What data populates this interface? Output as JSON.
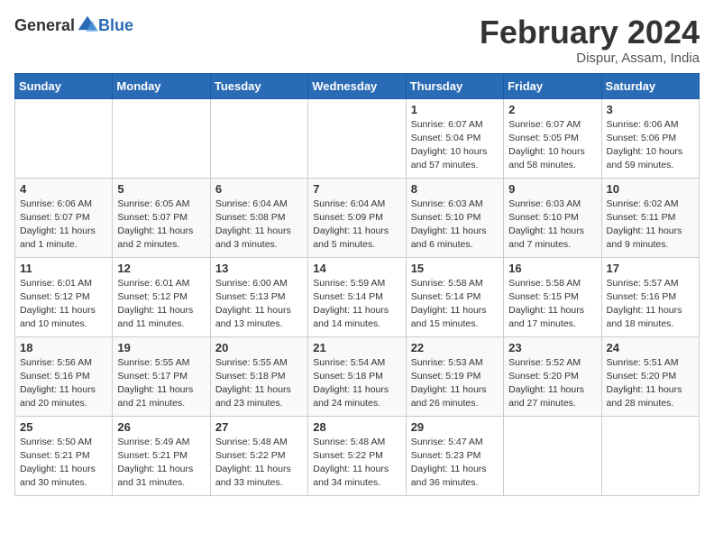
{
  "header": {
    "logo_general": "General",
    "logo_blue": "Blue",
    "month_title": "February 2024",
    "location": "Dispur, Assam, India"
  },
  "weekdays": [
    "Sunday",
    "Monday",
    "Tuesday",
    "Wednesday",
    "Thursday",
    "Friday",
    "Saturday"
  ],
  "weeks": [
    [
      {
        "day": "",
        "info": ""
      },
      {
        "day": "",
        "info": ""
      },
      {
        "day": "",
        "info": ""
      },
      {
        "day": "",
        "info": ""
      },
      {
        "day": "1",
        "info": "Sunrise: 6:07 AM\nSunset: 5:04 PM\nDaylight: 10 hours\nand 57 minutes."
      },
      {
        "day": "2",
        "info": "Sunrise: 6:07 AM\nSunset: 5:05 PM\nDaylight: 10 hours\nand 58 minutes."
      },
      {
        "day": "3",
        "info": "Sunrise: 6:06 AM\nSunset: 5:06 PM\nDaylight: 10 hours\nand 59 minutes."
      }
    ],
    [
      {
        "day": "4",
        "info": "Sunrise: 6:06 AM\nSunset: 5:07 PM\nDaylight: 11 hours\nand 1 minute."
      },
      {
        "day": "5",
        "info": "Sunrise: 6:05 AM\nSunset: 5:07 PM\nDaylight: 11 hours\nand 2 minutes."
      },
      {
        "day": "6",
        "info": "Sunrise: 6:04 AM\nSunset: 5:08 PM\nDaylight: 11 hours\nand 3 minutes."
      },
      {
        "day": "7",
        "info": "Sunrise: 6:04 AM\nSunset: 5:09 PM\nDaylight: 11 hours\nand 5 minutes."
      },
      {
        "day": "8",
        "info": "Sunrise: 6:03 AM\nSunset: 5:10 PM\nDaylight: 11 hours\nand 6 minutes."
      },
      {
        "day": "9",
        "info": "Sunrise: 6:03 AM\nSunset: 5:10 PM\nDaylight: 11 hours\nand 7 minutes."
      },
      {
        "day": "10",
        "info": "Sunrise: 6:02 AM\nSunset: 5:11 PM\nDaylight: 11 hours\nand 9 minutes."
      }
    ],
    [
      {
        "day": "11",
        "info": "Sunrise: 6:01 AM\nSunset: 5:12 PM\nDaylight: 11 hours\nand 10 minutes."
      },
      {
        "day": "12",
        "info": "Sunrise: 6:01 AM\nSunset: 5:12 PM\nDaylight: 11 hours\nand 11 minutes."
      },
      {
        "day": "13",
        "info": "Sunrise: 6:00 AM\nSunset: 5:13 PM\nDaylight: 11 hours\nand 13 minutes."
      },
      {
        "day": "14",
        "info": "Sunrise: 5:59 AM\nSunset: 5:14 PM\nDaylight: 11 hours\nand 14 minutes."
      },
      {
        "day": "15",
        "info": "Sunrise: 5:58 AM\nSunset: 5:14 PM\nDaylight: 11 hours\nand 15 minutes."
      },
      {
        "day": "16",
        "info": "Sunrise: 5:58 AM\nSunset: 5:15 PM\nDaylight: 11 hours\nand 17 minutes."
      },
      {
        "day": "17",
        "info": "Sunrise: 5:57 AM\nSunset: 5:16 PM\nDaylight: 11 hours\nand 18 minutes."
      }
    ],
    [
      {
        "day": "18",
        "info": "Sunrise: 5:56 AM\nSunset: 5:16 PM\nDaylight: 11 hours\nand 20 minutes."
      },
      {
        "day": "19",
        "info": "Sunrise: 5:55 AM\nSunset: 5:17 PM\nDaylight: 11 hours\nand 21 minutes."
      },
      {
        "day": "20",
        "info": "Sunrise: 5:55 AM\nSunset: 5:18 PM\nDaylight: 11 hours\nand 23 minutes."
      },
      {
        "day": "21",
        "info": "Sunrise: 5:54 AM\nSunset: 5:18 PM\nDaylight: 11 hours\nand 24 minutes."
      },
      {
        "day": "22",
        "info": "Sunrise: 5:53 AM\nSunset: 5:19 PM\nDaylight: 11 hours\nand 26 minutes."
      },
      {
        "day": "23",
        "info": "Sunrise: 5:52 AM\nSunset: 5:20 PM\nDaylight: 11 hours\nand 27 minutes."
      },
      {
        "day": "24",
        "info": "Sunrise: 5:51 AM\nSunset: 5:20 PM\nDaylight: 11 hours\nand 28 minutes."
      }
    ],
    [
      {
        "day": "25",
        "info": "Sunrise: 5:50 AM\nSunset: 5:21 PM\nDaylight: 11 hours\nand 30 minutes."
      },
      {
        "day": "26",
        "info": "Sunrise: 5:49 AM\nSunset: 5:21 PM\nDaylight: 11 hours\nand 31 minutes."
      },
      {
        "day": "27",
        "info": "Sunrise: 5:48 AM\nSunset: 5:22 PM\nDaylight: 11 hours\nand 33 minutes."
      },
      {
        "day": "28",
        "info": "Sunrise: 5:48 AM\nSunset: 5:22 PM\nDaylight: 11 hours\nand 34 minutes."
      },
      {
        "day": "29",
        "info": "Sunrise: 5:47 AM\nSunset: 5:23 PM\nDaylight: 11 hours\nand 36 minutes."
      },
      {
        "day": "",
        "info": ""
      },
      {
        "day": "",
        "info": ""
      }
    ]
  ]
}
